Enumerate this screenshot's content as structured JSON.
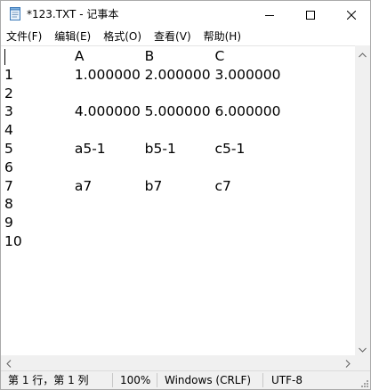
{
  "window": {
    "title": "*123.TXT - 记事本",
    "icon": "notepad-icon"
  },
  "title_buttons": {
    "minimize_icon": "minimize-icon",
    "maximize_icon": "maximize-icon",
    "close_icon": "close-icon"
  },
  "menu": {
    "items": [
      {
        "label": "文件(F)"
      },
      {
        "label": "编辑(E)"
      },
      {
        "label": "格式(O)"
      },
      {
        "label": "查看(V)"
      },
      {
        "label": "帮助(H)"
      }
    ]
  },
  "editor": {
    "lines": [
      "\t\tA\t\tB\t\tC",
      "1\t\t1.000000\t2.000000\t3.000000",
      "2",
      "3\t\t4.000000\t5.000000\t6.000000",
      "4",
      "5\t\ta5-1\t\tb5-1\t\tc5-1",
      "6",
      "7\t\ta7\t\tb7\t\tc7",
      "8",
      "9",
      "10"
    ]
  },
  "statusbar": {
    "position": "第 1 行，第 1 列",
    "zoom": "100%",
    "line_ending": "Windows (CRLF)",
    "encoding": "UTF-8"
  },
  "colors": {
    "chrome_bg": "#f0f0f0",
    "editor_bg": "#ffffff",
    "text": "#000000"
  }
}
